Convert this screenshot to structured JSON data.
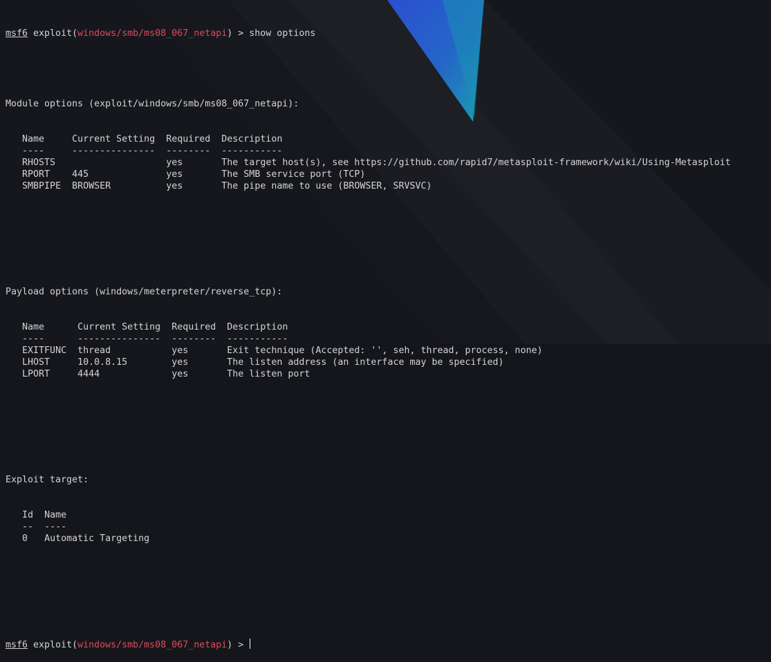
{
  "prompt": {
    "msf": "msf6",
    "exploit_label": " exploit(",
    "module": "windows/smb/ms08_067_netapi",
    "suffix": ") > ",
    "command": "show options"
  },
  "module_options": {
    "heading": "Module options (exploit/windows/smb/ms08_067_netapi):",
    "columns": [
      "Name",
      "Current Setting",
      "Required",
      "Description"
    ],
    "separators": [
      "----",
      "---------------",
      "--------",
      "-----------"
    ],
    "rows": [
      [
        "RHOSTS",
        "",
        "yes",
        "The target host(s), see https://github.com/rapid7/metasploit-framework/wiki/Using-Metasploit"
      ],
      [
        "RPORT",
        "445",
        "yes",
        "The SMB service port (TCP)"
      ],
      [
        "SMBPIPE",
        "BROWSER",
        "yes",
        "The pipe name to use (BROWSER, SRVSVC)"
      ]
    ]
  },
  "payload_options": {
    "heading": "Payload options (windows/meterpreter/reverse_tcp):",
    "columns": [
      "Name",
      "Current Setting",
      "Required",
      "Description"
    ],
    "separators": [
      "----",
      "---------------",
      "--------",
      "-----------"
    ],
    "rows": [
      [
        "EXITFUNC",
        "thread",
        "yes",
        "Exit technique (Accepted: '', seh, thread, process, none)"
      ],
      [
        "LHOST",
        "10.0.8.15",
        "yes",
        "The listen address (an interface may be specified)"
      ],
      [
        "LPORT",
        "4444",
        "yes",
        "The listen port"
      ]
    ]
  },
  "exploit_target": {
    "heading": "Exploit target:",
    "columns": [
      "Id",
      "Name"
    ],
    "separators": [
      "--",
      "----"
    ],
    "rows": [
      [
        "0",
        "Automatic Targeting"
      ]
    ]
  },
  "colors": {
    "background": "#15161b",
    "text": "#d4d4d4",
    "module": "#e04a5a",
    "accent_blue": "#2f6fd6",
    "accent_teal": "#1a9ab0"
  }
}
